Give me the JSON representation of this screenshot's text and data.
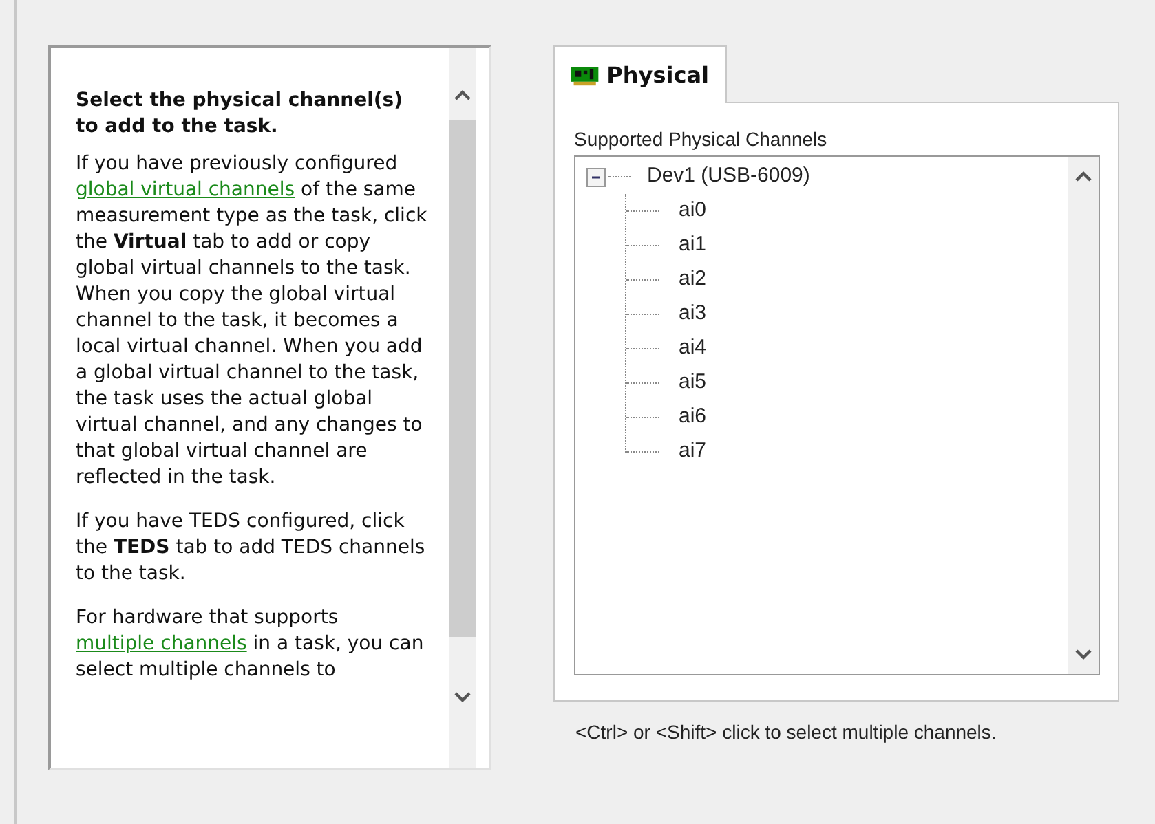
{
  "help": {
    "heading": "Select the physical channel(s) to add to the task.",
    "paragraphs": [
      [
        {
          "kind": "text",
          "text": "If you have previously configured "
        },
        {
          "kind": "link",
          "text": "global virtual channels"
        },
        {
          "kind": "text",
          "text": " of the same measurement type as the task, click the "
        },
        {
          "kind": "bold",
          "text": "Virtual"
        },
        {
          "kind": "text",
          "text": " tab to add or copy global virtual channels to the task. When you copy the global virtual channel to the task, it becomes a local virtual channel. When you add a global virtual channel to the task, the task uses the actual global virtual channel, and any changes to that global virtual channel are reflected in the task."
        }
      ],
      [
        {
          "kind": "text",
          "text": "If you have TEDS configured, click the "
        },
        {
          "kind": "bold",
          "text": "TEDS"
        },
        {
          "kind": "text",
          "text": " tab to add TEDS channels to the task."
        }
      ],
      [
        {
          "kind": "text",
          "text": "For hardware that supports "
        },
        {
          "kind": "link",
          "text": "multiple channels"
        },
        {
          "kind": "text",
          "text": " in a task, you can select multiple channels to"
        }
      ]
    ]
  },
  "tabs": [
    {
      "label": "Physical",
      "selected": true
    }
  ],
  "channels_label": "Supported Physical Channels",
  "tree": [
    {
      "label": "Dev1  (USB-6009)",
      "expanded": true,
      "children": [
        {
          "label": "ai0"
        },
        {
          "label": "ai1"
        },
        {
          "label": "ai2"
        },
        {
          "label": "ai3"
        },
        {
          "label": "ai4"
        },
        {
          "label": "ai5"
        },
        {
          "label": "ai6"
        },
        {
          "label": "ai7"
        }
      ]
    }
  ],
  "hint": "<Ctrl> or <Shift> click to select multiple channels."
}
